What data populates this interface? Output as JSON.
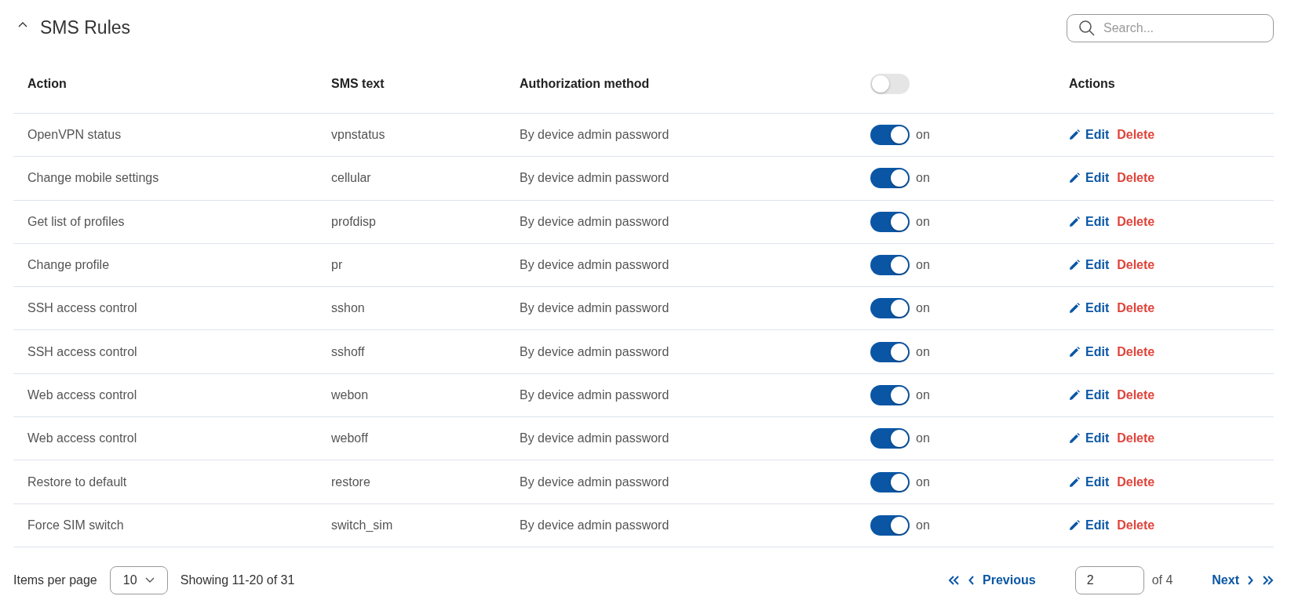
{
  "section": {
    "title": "SMS Rules",
    "expanded": true
  },
  "search": {
    "placeholder": "Search..."
  },
  "table": {
    "columns": [
      "Action",
      "SMS text",
      "Authorization method",
      "Actions"
    ],
    "header_toggle": {
      "on": false
    },
    "rows": [
      {
        "action": "OpenVPN status",
        "sms_text": "vpnstatus",
        "auth": "By device admin password",
        "on": true,
        "state_text": "on",
        "edit": "Edit",
        "delete": "Delete"
      },
      {
        "action": "Change mobile settings",
        "sms_text": "cellular",
        "auth": "By device admin password",
        "on": true,
        "state_text": "on",
        "edit": "Edit",
        "delete": "Delete"
      },
      {
        "action": "Get list of profiles",
        "sms_text": "profdisp",
        "auth": "By device admin password",
        "on": true,
        "state_text": "on",
        "edit": "Edit",
        "delete": "Delete"
      },
      {
        "action": "Change profile",
        "sms_text": "pr",
        "auth": "By device admin password",
        "on": true,
        "state_text": "on",
        "edit": "Edit",
        "delete": "Delete"
      },
      {
        "action": "SSH access control",
        "sms_text": "sshon",
        "auth": "By device admin password",
        "on": true,
        "state_text": "on",
        "edit": "Edit",
        "delete": "Delete"
      },
      {
        "action": "SSH access control",
        "sms_text": "sshoff",
        "auth": "By device admin password",
        "on": true,
        "state_text": "on",
        "edit": "Edit",
        "delete": "Delete"
      },
      {
        "action": "Web access control",
        "sms_text": "webon",
        "auth": "By device admin password",
        "on": true,
        "state_text": "on",
        "edit": "Edit",
        "delete": "Delete"
      },
      {
        "action": "Web access control",
        "sms_text": "weboff",
        "auth": "By device admin password",
        "on": true,
        "state_text": "on",
        "edit": "Edit",
        "delete": "Delete"
      },
      {
        "action": "Restore to default",
        "sms_text": "restore",
        "auth": "By device admin password",
        "on": true,
        "state_text": "on",
        "edit": "Edit",
        "delete": "Delete"
      },
      {
        "action": "Force SIM switch",
        "sms_text": "switch_sim",
        "auth": "By device admin password",
        "on": true,
        "state_text": "on",
        "edit": "Edit",
        "delete": "Delete"
      }
    ]
  },
  "footer": {
    "items_per_page_label": "Items per page",
    "items_per_page": "10",
    "showing": "Showing 11-20 of 31",
    "previous": "Previous",
    "page": "2",
    "of_pages": "of 4",
    "next": "Next"
  }
}
